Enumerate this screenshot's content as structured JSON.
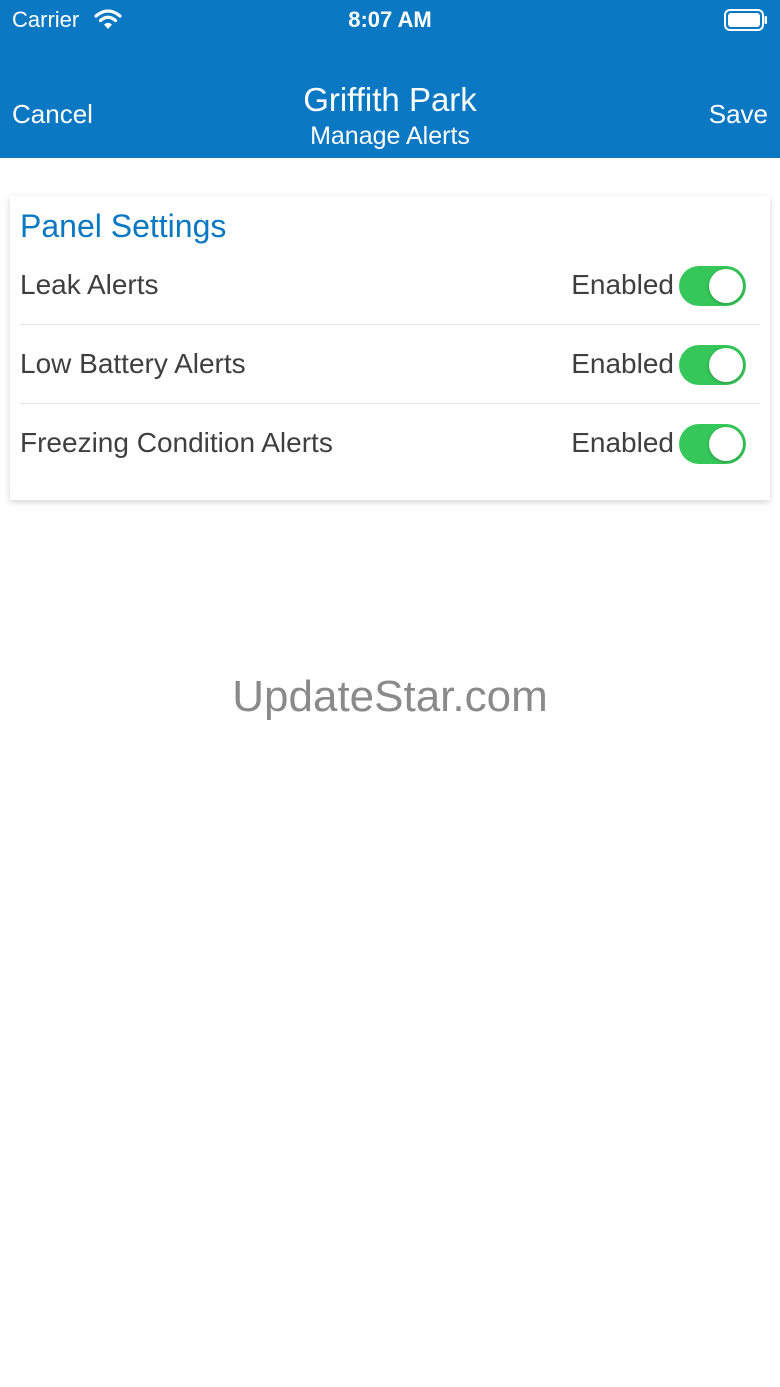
{
  "status_bar": {
    "carrier": "Carrier",
    "time": "8:07 AM",
    "wifi_icon": "wifi-icon",
    "battery_icon": "battery-full-icon"
  },
  "nav": {
    "cancel_label": "Cancel",
    "title": "Griffith Park",
    "subtitle": "Manage Alerts",
    "save_label": "Save"
  },
  "panel": {
    "title": "Panel Settings",
    "rows": [
      {
        "label": "Leak Alerts",
        "status": "Enabled",
        "on": true
      },
      {
        "label": "Low Battery Alerts",
        "status": "Enabled",
        "on": true
      },
      {
        "label": "Freezing Condition Alerts",
        "status": "Enabled",
        "on": true
      }
    ]
  },
  "watermark": "UpdateStar.com",
  "colors": {
    "header_blue": "#0a78c2",
    "toggle_green": "#35c759",
    "text_gray": "#3f3f3f"
  }
}
